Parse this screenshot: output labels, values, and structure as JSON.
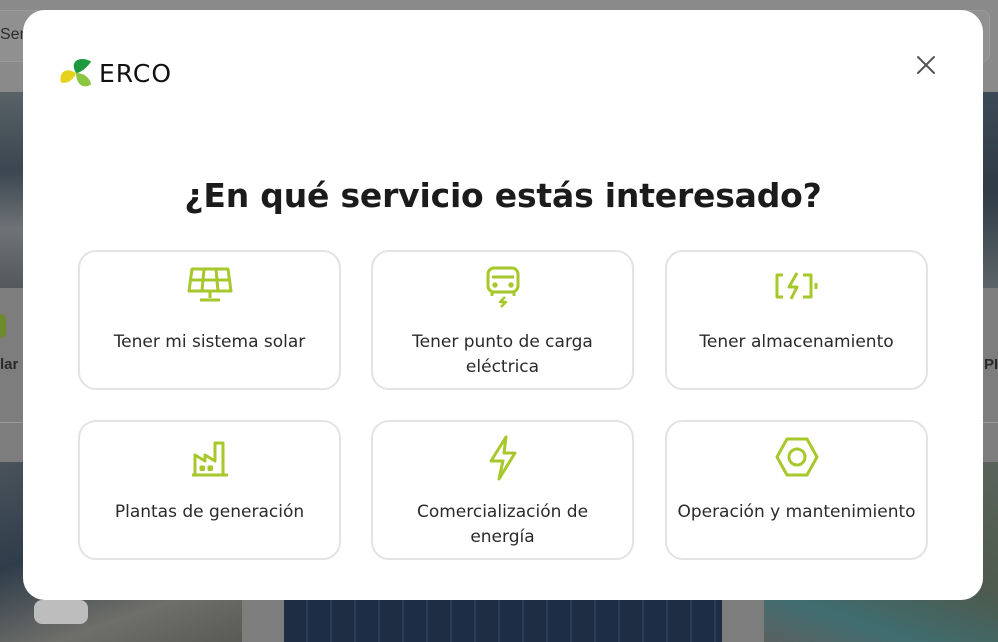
{
  "background": {
    "search_text": "Servici",
    "card_left_label": "lar",
    "card_right_label": "PI"
  },
  "modal": {
    "logo_text": "ERCO",
    "close_icon": "close-icon",
    "title": "¿En qué servicio estás interesado?",
    "accent_color": "#a6c82a",
    "options": [
      {
        "label": "Tener mi sistema solar",
        "icon": "solar-panel-icon"
      },
      {
        "label": "Tener punto de carga eléctrica",
        "icon": "ev-charger-icon"
      },
      {
        "label": "Tener almacenamiento",
        "icon": "battery-charging-icon"
      },
      {
        "label": "Plantas de generación",
        "icon": "factory-icon"
      },
      {
        "label": "Comercialización de energía",
        "icon": "lightning-icon"
      },
      {
        "label": "Operación y mantenimiento",
        "icon": "hex-nut-icon"
      }
    ]
  }
}
